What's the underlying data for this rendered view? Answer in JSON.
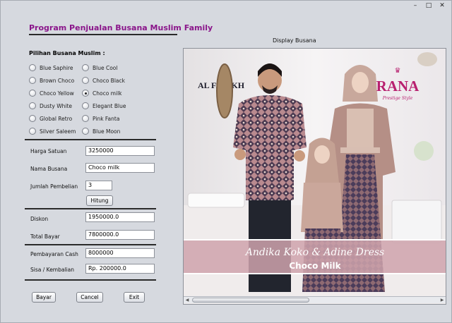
{
  "app": {
    "title": "Program Penjualan Busana Muslim Family"
  },
  "window_controls": {
    "minimize": "–",
    "maximize": "□",
    "close": "✕"
  },
  "choices": {
    "label": "Pilihan Busana Muslim :",
    "selected": "Choco milk",
    "left": [
      "Blue Saphire",
      "Brown Choco",
      "Choco Yellow",
      "Dusty White",
      "Global Retro",
      "Silver Saleem"
    ],
    "right": [
      "Blue Cool",
      "Choco Black",
      "Choco milk",
      "Elegant Blue",
      "Pink Fanta",
      "Blue Moon"
    ]
  },
  "form": {
    "harga_label": "Harga Satuan",
    "harga_value": "3250000",
    "nama_label": "Nama Busana",
    "nama_value": "Choco milk",
    "jumlah_label": "Jumlah Pembelian",
    "jumlah_value": "3",
    "hitung_label": "Hitung",
    "diskon_label": "Diskon",
    "diskon_value": "1950000.0",
    "total_label": "Total Bayar",
    "total_value": "7800000.0",
    "cash_label": "Pembayaran Cash",
    "cash_value": "8000000",
    "sisa_label": "Sisa / Kembalian",
    "sisa_value": "Rp. 200000.0"
  },
  "buttons": {
    "bayar": "Bayar",
    "cancel": "Cancel",
    "exit": "Exit"
  },
  "display": {
    "label": "Display Busana",
    "logo_left": "AL FARIKH",
    "logo_right": "RANA",
    "logo_right_sub": "Prestige Style",
    "banner_script": "Andika Koko & Adine Dress",
    "banner_name": "Choco Milk"
  },
  "colors": {
    "title": "#8a158a",
    "background": "#d6d9df"
  }
}
